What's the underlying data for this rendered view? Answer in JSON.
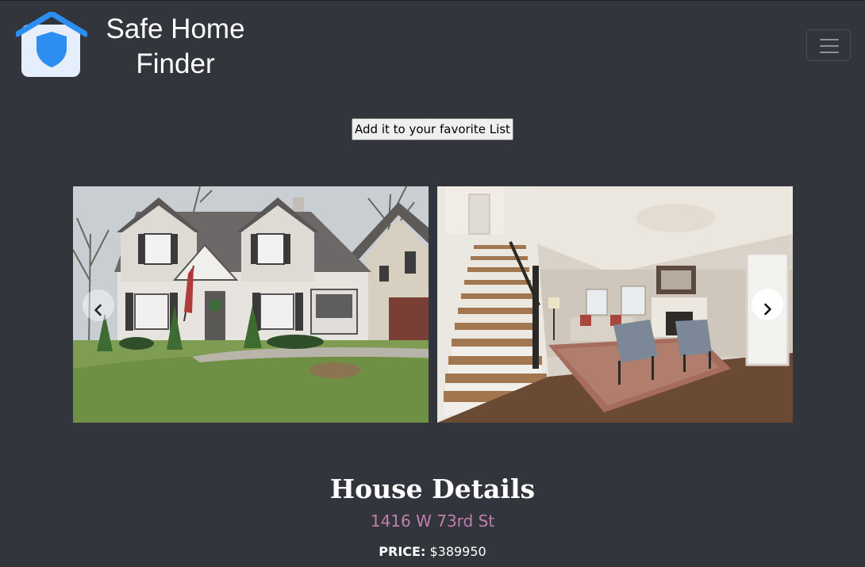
{
  "header": {
    "brand_line1": "Safe Home",
    "brand_line2": "Finder",
    "logo_icon": "house-shield-icon",
    "menu_icon": "hamburger-menu-icon"
  },
  "actions": {
    "favorite_label": "Add it to your favorite List"
  },
  "carousel": {
    "slides": [
      {
        "name": "house-exterior-photo"
      },
      {
        "name": "living-room-interior-photo"
      }
    ],
    "prev_icon": "chevron-left-icon",
    "next_icon": "chevron-right-icon"
  },
  "details": {
    "title": "House Details",
    "address": "1416 W 73rd St",
    "price_label": "PRICE:",
    "price_value": "$389950"
  },
  "colors": {
    "background": "#32353b",
    "logo_blue": "#2b8ef0",
    "address_pink": "#c07fac"
  }
}
